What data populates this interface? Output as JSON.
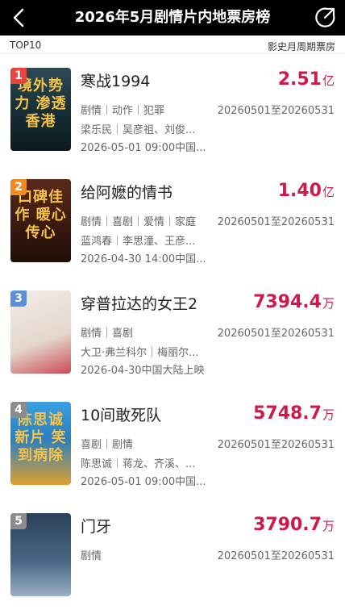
{
  "header": {
    "title": "2026年5月剧情片内地票房榜"
  },
  "subheader": {
    "left": "TOP10",
    "right": "影史月周期票房"
  },
  "items": [
    {
      "rank": "1",
      "title": "寒战1994",
      "box": "2.51",
      "unit": "亿",
      "genres": "剧情｜动作｜犯罪",
      "period": "20260501至20260531",
      "cast": "梁乐民｜吴彦祖、刘俊...",
      "release": "2026-05-01 09:00中国...",
      "poster_text": "境外势力 渗透香港"
    },
    {
      "rank": "2",
      "title": "给阿嬷的情书",
      "box": "1.40",
      "unit": "亿",
      "genres": "剧情｜喜剧｜爱情｜家庭",
      "period": "20260501至20260531",
      "cast": "蓝鸿春｜李思潼、王彦...",
      "release": "2026-04-30 14:00中国...",
      "poster_text": "口碑佳作 暖心传心"
    },
    {
      "rank": "3",
      "title": "穿普拉达的女王2",
      "box": "7394.4",
      "unit": "万",
      "genres": "剧情｜喜剧",
      "period": "20260501至20260531",
      "cast": "大卫·弗兰科尔｜梅丽尔...",
      "release": "2026-04-30中国大陆上映",
      "poster_text": ""
    },
    {
      "rank": "4",
      "title": "10间敢死队",
      "box": "5748.7",
      "unit": "万",
      "genres": "喜剧｜剧情",
      "period": "20260501至20260531",
      "cast": "陈思诚｜蒋龙、齐溪、...",
      "release": "2026-05-01 09:00中国...",
      "poster_text": "陈思诚新片 笑到病除"
    },
    {
      "rank": "5",
      "title": "门牙",
      "box": "3790.7",
      "unit": "万",
      "genres": "剧情",
      "period": "20260501至20260531",
      "cast": "",
      "release": "",
      "poster_text": ""
    }
  ],
  "colors": {
    "price": "#d0194a",
    "rank_badges": [
      "#e8453c",
      "#f08a24",
      "#5b8fd9",
      "#8c8c8c",
      "#8c8c8c"
    ]
  }
}
